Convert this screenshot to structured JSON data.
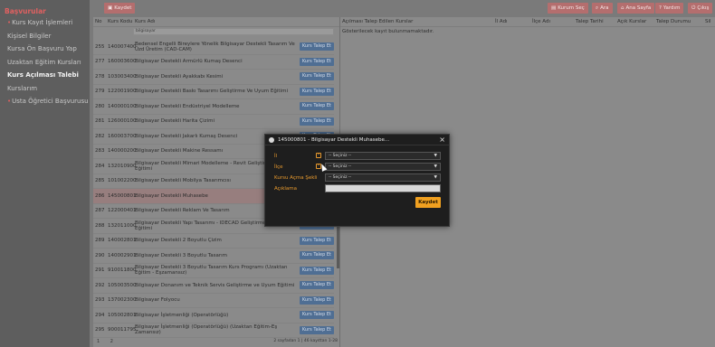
{
  "sidebar": {
    "title": "Başvurular",
    "items": [
      {
        "label": "Kurs Kayıt İşlemleri",
        "bullet": true
      },
      {
        "label": "Kişisel Bilgiler",
        "bullet": false
      },
      {
        "label": "Kursa Ön Başvuru Yap",
        "bullet": false
      },
      {
        "label": "Uzaktan Eğitim Kursları",
        "bullet": false
      },
      {
        "label": "Kurs Açılması Talebi",
        "bullet": false,
        "active": true
      },
      {
        "label": "Kurslarım",
        "bullet": false
      },
      {
        "label": "Usta Öğretici Başvurusu",
        "bullet": true
      }
    ]
  },
  "toolbar": {
    "kaydet": "Kaydet",
    "kurum_sec": "Kurum Seç",
    "ara": "Ara",
    "ana_sayfa": "Ana Sayfa",
    "yardim": "Yardım",
    "cikis": "Çıkış"
  },
  "course_list": {
    "headers": {
      "no": "No",
      "code": "Kurs Kodu",
      "name": "Kurs Adı"
    },
    "filter_value": "bilgisayar",
    "request_label": "Kurs Talep Et",
    "rows": [
      {
        "no": "255",
        "code": "140007400",
        "name": "Bedensel Engelli Bireylere Yönelik Bilgisayar Destekli Tasarım Ve Üzd Üretim (CAD-CAM)"
      },
      {
        "no": "277",
        "code": "160003600",
        "name": "Bilgisayar Destekli Armürlü Kumaş Desenci"
      },
      {
        "no": "278",
        "code": "103003400",
        "name": "Bilgisayar Destekli Ayakkabı Kesimi"
      },
      {
        "no": "279",
        "code": "122001900",
        "name": "Bilgisayar Destekli Baskı Tasarımı Geliştirme Ve Uyum Eğitimi"
      },
      {
        "no": "280",
        "code": "140000100",
        "name": "Bilgisayar Destekli Endüstriyel Modelleme"
      },
      {
        "no": "281",
        "code": "126000100",
        "name": "Bilgisayar Destekli Harita Çizimi"
      },
      {
        "no": "282",
        "code": "160003700",
        "name": "Bilgisayar Destekli Jakarlı Kumaş Desenci"
      },
      {
        "no": "283",
        "code": "140000200",
        "name": "Bilgisayar Destekli Makine Ressamı"
      },
      {
        "no": "284",
        "code": "132010900",
        "name": "Bilgisayar Destekli Mimari Modelleme - Revit Geliştirme ve Uyum Eğitimi"
      },
      {
        "no": "285",
        "code": "101002200",
        "name": "Bilgisayar Destekli Mobilya Tasarımcısı"
      },
      {
        "no": "286",
        "code": "145000801",
        "name": "Bilgisayar Destekli Muhasebe",
        "selected": true
      },
      {
        "no": "287",
        "code": "122000401",
        "name": "Bilgisayar Destekli Reklam Ve Tasarım"
      },
      {
        "no": "288",
        "code": "132011000",
        "name": "Bilgisayar Destekli Yapı Tasarımı - IDECAD Geliştirme ve Uyum Eğitimi"
      },
      {
        "no": "289",
        "code": "140002801",
        "name": "Bilgisayar Destekli 2 Boyutlu Çizim"
      },
      {
        "no": "290",
        "code": "140002901",
        "name": "Bilgisayar Destekli 3 Boyutlu Tasarım"
      },
      {
        "no": "291",
        "code": "910011800",
        "name": "Bilgisayar Destekli 3 Boyutlu Tasarım Kurs Programı (Uzaktan Eğitim - Eşzamansız)"
      },
      {
        "no": "292",
        "code": "105003500",
        "name": "Bilgisayar Donanım ve Teknik Servis Geliştirme ve Uyum Eğitimi"
      },
      {
        "no": "293",
        "code": "137002300",
        "name": "Bilgisayar Folyocu"
      },
      {
        "no": "294",
        "code": "105002801",
        "name": "Bilgisayar İşletmenliği (Operatörlüğü)"
      },
      {
        "no": "295",
        "code": "900011795",
        "name": "Bilgisayar İşletmenliği (Operatörlüğü) (Uzaktan Eğitim-Eş Zamansız)"
      }
    ],
    "pages": [
      "1",
      "2"
    ],
    "pagination_info": "2 sayfadan 1 | 46 kayıttan 1-28"
  },
  "requests_panel": {
    "headers": [
      "Açılması Talep Edilen Kurslar",
      "İl Adı",
      "İlçe Adı",
      "Talep Tarihi",
      "Açık Kurslar",
      "Talep Durumu",
      "Sil"
    ],
    "empty_text": "Gösterilecek kayıt bulunmamaktadır."
  },
  "modal": {
    "title": "145000801 - Bilgisayar Destekli Muhasebe...",
    "close": "×",
    "fields": [
      {
        "label": "İl",
        "type": "select",
        "value": "-- Seçiniz --",
        "required": true
      },
      {
        "label": "İlçe",
        "type": "select",
        "value": "-- Seçiniz --",
        "required": true
      },
      {
        "label": "Kursu Açma Şekli",
        "type": "select",
        "value": "-- Seçiniz --",
        "required": false
      },
      {
        "label": "Açıklama",
        "type": "text",
        "value": "",
        "required": false
      }
    ],
    "save_label": "Kaydet",
    "required_mark": "*"
  },
  "colors": {
    "accent_red": "#e06060",
    "request_button": "#4f6e93",
    "save_button": "#f0a020",
    "modal_label": "#e89a2e"
  },
  "icons": [
    "save-icon",
    "building-icon",
    "search-icon",
    "home-icon",
    "help-icon",
    "logout-icon",
    "close-icon"
  ]
}
